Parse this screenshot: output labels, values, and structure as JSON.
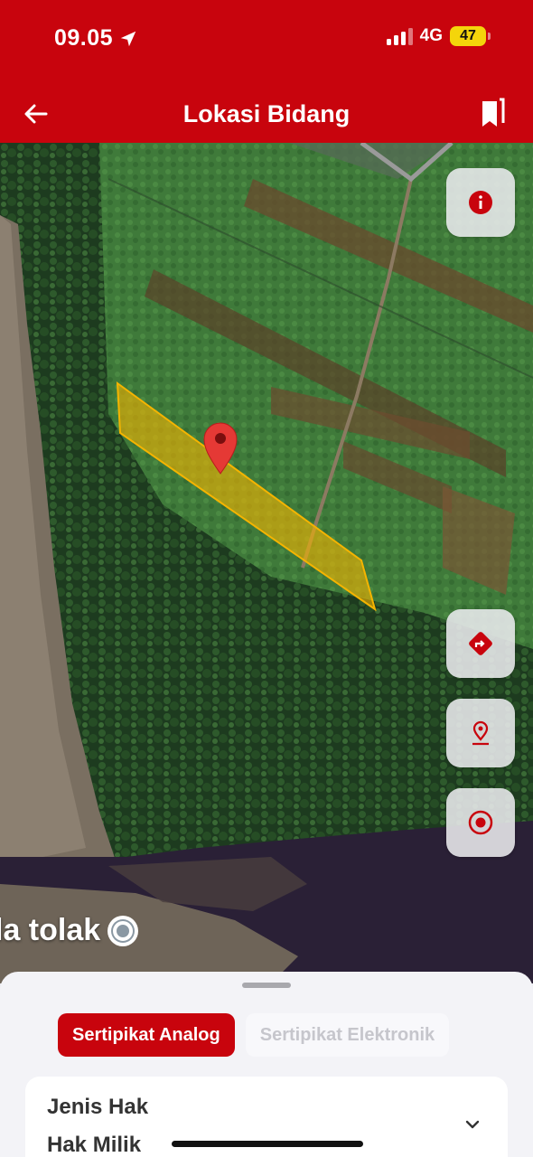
{
  "status_bar": {
    "time": "09.05",
    "network": "4G",
    "battery": "47"
  },
  "header": {
    "title": "Lokasi Bidang",
    "background_color": "#c8040d"
  },
  "map": {
    "place_label": "la tolak",
    "parcel_color": "#f5b400",
    "marker_color": "#e53935",
    "controls": [
      {
        "name": "info-button",
        "icon": "info-icon"
      },
      {
        "name": "directions-button",
        "icon": "directions-icon"
      },
      {
        "name": "drop-pin-button",
        "icon": "pin-icon"
      },
      {
        "name": "my-location-button",
        "icon": "target-icon"
      }
    ]
  },
  "sheet": {
    "tabs": [
      {
        "label": "Sertipikat Analog",
        "active": true
      },
      {
        "label": "Sertipikat Elektronik",
        "active": false
      }
    ],
    "field_label": "Jenis Hak",
    "field_value": "Hak Milik"
  }
}
